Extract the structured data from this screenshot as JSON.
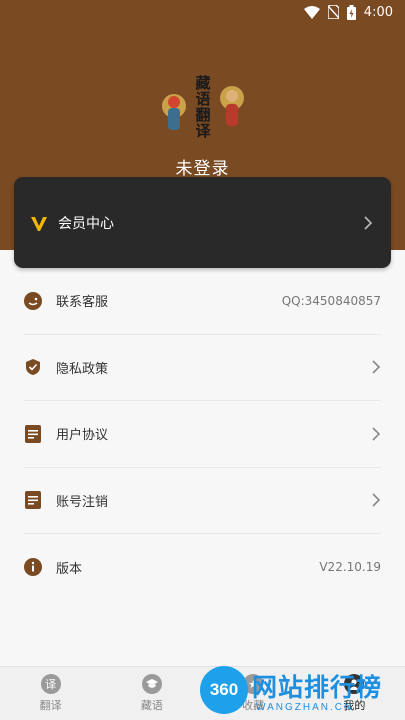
{
  "status_bar": {
    "time": "4:00"
  },
  "header": {
    "login_title": "未登录",
    "logo_text": "藏语翻译"
  },
  "vip": {
    "label": "会员中心"
  },
  "menu": {
    "items": [
      {
        "label": "联系客服",
        "value": "QQ:3450840857"
      },
      {
        "label": "隐私政策"
      },
      {
        "label": "用户协议"
      },
      {
        "label": "账号注销"
      },
      {
        "label": "版本",
        "value": "V22.10.19"
      }
    ]
  },
  "tabbar": {
    "tabs": [
      {
        "label": "翻译",
        "icon_char": "译"
      },
      {
        "label": "藏语",
        "icon_char": ""
      },
      {
        "label": "收藏",
        "icon_char": "★"
      },
      {
        "label": "我的",
        "icon_char": ""
      }
    ]
  },
  "watermark": {
    "badge": "360",
    "title": "网站排行榜",
    "subtitle": "WANGZHAN.CN"
  },
  "colors": {
    "header_bg": "#7a4a22",
    "accent": "#7a4a22",
    "vip_card": "#2a2929",
    "vip_logo": "#f2b705"
  }
}
